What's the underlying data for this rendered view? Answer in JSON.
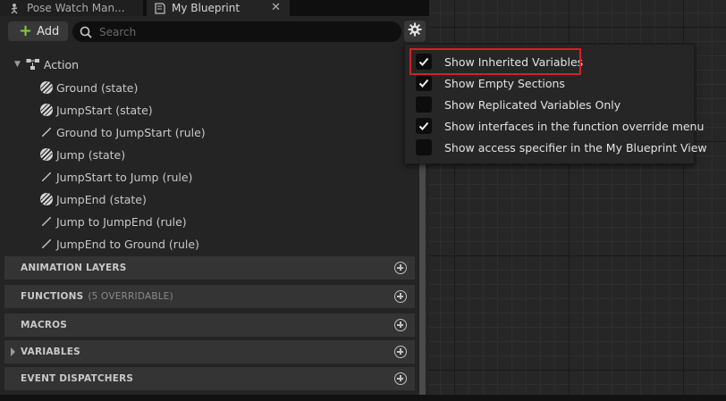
{
  "tabs": [
    {
      "label": "Pose Watch Man...",
      "icon": "pose-watch-icon"
    },
    {
      "label": "My Blueprint",
      "icon": "blueprint-icon",
      "close": "✕"
    }
  ],
  "toolbar": {
    "add_label": "Add",
    "search_placeholder": "Search",
    "settings_icon": "gear-icon"
  },
  "tree": {
    "header": "Action",
    "items": [
      {
        "label": "Ground (state)",
        "icon": "state-icon"
      },
      {
        "label": "JumpStart (state)",
        "icon": "state-icon"
      },
      {
        "label": "Ground to JumpStart (rule)",
        "icon": "rule-icon"
      },
      {
        "label": "Jump (state)",
        "icon": "state-icon"
      },
      {
        "label": "JumpStart to Jump (rule)",
        "icon": "rule-icon"
      },
      {
        "label": "JumpEnd (state)",
        "icon": "state-icon"
      },
      {
        "label": "Jump to JumpEnd (rule)",
        "icon": "rule-icon"
      },
      {
        "label": "JumpEnd to Ground (rule)",
        "icon": "rule-icon"
      }
    ]
  },
  "sections": [
    {
      "label": "ANIMATION LAYERS",
      "sub": ""
    },
    {
      "label": "FUNCTIONS",
      "sub": "(5 OVERRIDABLE)"
    },
    {
      "label": "MACROS",
      "sub": ""
    },
    {
      "label": "VARIABLES",
      "sub": ""
    },
    {
      "label": "EVENT DISPATCHERS",
      "sub": ""
    }
  ],
  "menu": {
    "items": [
      {
        "label": "Show Inherited Variables",
        "checked": true
      },
      {
        "label": "Show Empty Sections",
        "checked": true
      },
      {
        "label": "Show Replicated Variables Only",
        "checked": false
      },
      {
        "label": "Show interfaces in the function override menu",
        "checked": true
      },
      {
        "label": "Show access specifier in the My Blueprint View",
        "checked": false
      }
    ]
  },
  "colors": {
    "add_plus": "#7fcc3e",
    "highlight": "#d3202a",
    "panel": "#242424"
  }
}
